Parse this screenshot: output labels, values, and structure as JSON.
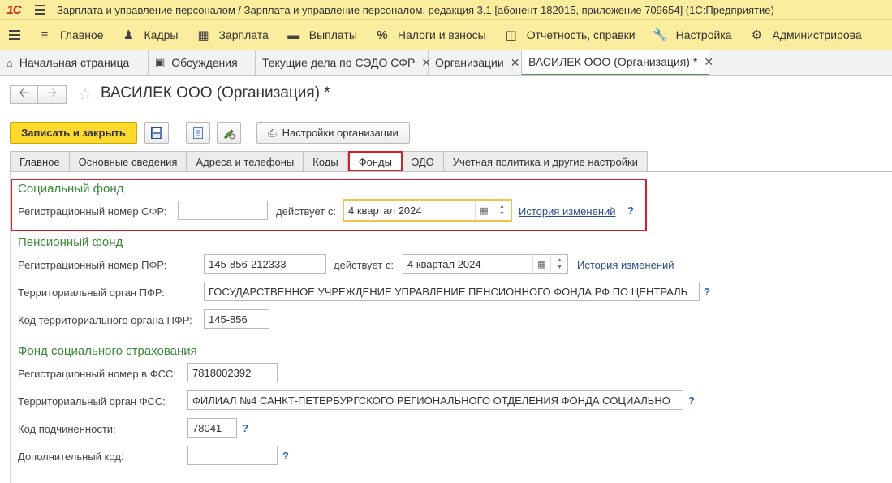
{
  "app": {
    "logo": "1С",
    "title": "Зарплата и управление персоналом / Зарплата и управление персоналом, редакция 3.1 [абонент 182015, приложение 709654]  (1С:Предприятие)"
  },
  "main_menu": [
    {
      "label": "Главное",
      "icon": "home-icon"
    },
    {
      "label": "Кадры",
      "icon": "people-icon"
    },
    {
      "label": "Зарплата",
      "icon": "calculator-icon"
    },
    {
      "label": "Выплаты",
      "icon": "wallet-icon"
    },
    {
      "label": "Налоги и взносы",
      "icon": "percent-icon"
    },
    {
      "label": "Отчетность, справки",
      "icon": "report-icon"
    },
    {
      "label": "Настройка",
      "icon": "wrench-icon"
    },
    {
      "label": "Администрирова",
      "icon": "gear-icon"
    }
  ],
  "open_tabs": [
    {
      "label": "Начальная страница",
      "icon": "home-icon",
      "closable": false
    },
    {
      "label": "Обсуждения",
      "icon": "chat-icon",
      "closable": false
    },
    {
      "label": "Текущие дела по СЭДО СФР",
      "closable": true
    },
    {
      "label": "Организации",
      "closable": true
    },
    {
      "label": "ВАСИЛЕК ООО (Организация) *",
      "closable": true
    }
  ],
  "form": {
    "title": "ВАСИЛЕК ООО (Организация) *",
    "toolbar": {
      "save_close": "Записать и закрыть",
      "org_settings": "Настройки организации"
    },
    "tabs": [
      "Главное",
      "Основные сведения",
      "Адреса и телефоны",
      "Коды",
      "Фонды",
      "ЭДО",
      "Учетная политика и другие настройки"
    ],
    "active_tab": "Фонды"
  },
  "sfr": {
    "heading": "Социальный фонд",
    "reg_label": "Регистрационный номер СФР:",
    "reg_value": "",
    "valid_label": "действует с:",
    "valid_value": "4 квартал 2024",
    "history": "История изменений",
    "help": "?"
  },
  "pfr": {
    "heading": "Пенсионный фонд",
    "reg_label": "Регистрационный номер ПФР:",
    "reg_value": "145-856-212333",
    "valid_label": "действует с:",
    "valid_value": "4 квартал 2024",
    "history": "История изменений",
    "org_label": "Территориальный орган ПФР:",
    "org_value": "ГОСУДАРСТВЕННОЕ УЧРЕЖДЕНИЕ УПРАВЛЕНИЕ ПЕНСИОННОГО ФОНДА РФ ПО ЦЕНТРАЛЬ",
    "org_help": "?",
    "code_label": "Код территориального органа ПФР:",
    "code_value": "145-856"
  },
  "fss": {
    "heading": "Фонд социального страхования",
    "reg_label": "Регистрационный номер в ФСС:",
    "reg_value": "7818002392",
    "org_label": "Территориальный орган ФСС:",
    "org_value": "ФИЛИАЛ №4 САНКТ-ПЕТЕРБУРГСКОГО РЕГИОНАЛЬНОГО ОТДЕЛЕНИЯ ФОНДА СОЦИАЛЬНО",
    "org_help": "?",
    "sub_label": "Код подчиненности:",
    "sub_value": "78041",
    "sub_help": "?",
    "extra_label": "Дополнительный код:",
    "extra_value": "",
    "extra_help": "?"
  },
  "colors": {
    "panel": "#fbed9e",
    "primary_button": "#fcd92c",
    "section": "#3a8a3a",
    "highlight": "#d0202a",
    "link": "#2b4c8c"
  }
}
